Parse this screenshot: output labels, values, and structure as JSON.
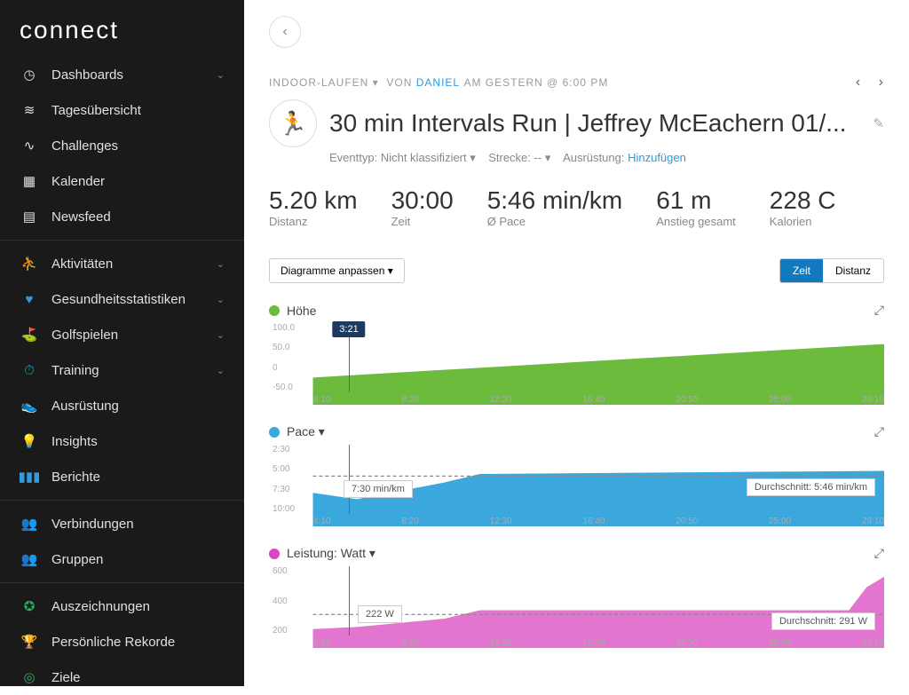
{
  "logo": "connect",
  "nav": {
    "dashboards": "Dashboards",
    "tagesuebersicht": "Tagesübersicht",
    "challenges": "Challenges",
    "kalender": "Kalender",
    "newsfeed": "Newsfeed",
    "aktivitaeten": "Aktivitäten",
    "gesundheit": "Gesundheitsstatistiken",
    "golf": "Golfspielen",
    "training": "Training",
    "ausruestung": "Ausrüstung",
    "insights": "Insights",
    "berichte": "Berichte",
    "verbindungen": "Verbindungen",
    "gruppen": "Gruppen",
    "auszeichnungen": "Auszeichnungen",
    "rekorde": "Persönliche Rekorde",
    "ziele": "Ziele"
  },
  "crumb": {
    "type": "INDOOR-LAUFEN",
    "pre": "VON",
    "user": "DANIEL",
    "time": "AM GESTERN @ 6:00 PM"
  },
  "title": "30 min Intervals Run | Jeffrey McEachern 01/...",
  "subline": {
    "eventtyp_lbl": "Eventtyp:",
    "eventtyp_val": "Nicht klassifiziert",
    "strecke_lbl": "Strecke:",
    "strecke_val": "--",
    "ausruestung_lbl": "Ausrüstung:",
    "ausruestung_link": "Hinzufügen"
  },
  "stats": {
    "distanz_val": "5.20 km",
    "distanz_lbl": "Distanz",
    "zeit_val": "30:00",
    "zeit_lbl": "Zeit",
    "pace_val": "5:46 min/km",
    "pace_lbl": "Ø Pace",
    "anstieg_val": "61 m",
    "anstieg_lbl": "Anstieg gesamt",
    "kal_val": "228 C",
    "kal_lbl": "Kalorien"
  },
  "tools": {
    "customize": "Diagramme anpassen ▾",
    "zeit": "Zeit",
    "distanz": "Distanz"
  },
  "charts": {
    "hoehe": {
      "title": "Höhe",
      "color": "#6cbb3c",
      "cursor_time": "3:21"
    },
    "pace": {
      "title": "Pace ▾",
      "color": "#3ba8dd",
      "cursor_val": "7:30 min/km",
      "avg": "Durchschnitt: 5:46 min/km"
    },
    "leistung": {
      "title": "Leistung: Watt ▾",
      "color": "#d946bf",
      "cursor_val": "222 W",
      "avg": "Durchschnitt: 291 W"
    },
    "xticks": [
      "4:10",
      "8:20",
      "12:30",
      "16:40",
      "20:50",
      "25:00",
      "29:10"
    ],
    "hoehe_yticks": [
      "100.0",
      "50.0",
      "0",
      "-50.0"
    ],
    "pace_yticks": [
      "2:30",
      "5:00",
      "7:30",
      "10:00"
    ],
    "leistung_yticks": [
      "600",
      "400",
      "200"
    ]
  },
  "chart_data": [
    {
      "type": "area",
      "title": "Höhe",
      "ylabel": "m",
      "ylim": [
        -50,
        100
      ],
      "x": [
        0,
        4.17,
        8.33,
        12.5,
        16.67,
        20.83,
        25.0,
        29.17,
        30
      ],
      "values": [
        0,
        8,
        16,
        24,
        32,
        40,
        48,
        56,
        61
      ]
    },
    {
      "type": "area",
      "title": "Pace",
      "ylabel": "min/km",
      "ylim": [
        10,
        2.5
      ],
      "x": [
        0,
        3.35,
        4.17,
        8.33,
        12.5,
        16.67,
        20.83,
        25.0,
        29.17,
        30
      ],
      "values": [
        7.0,
        7.5,
        7.3,
        6.0,
        5.3,
        5.3,
        5.3,
        5.3,
        5.0,
        4.0
      ],
      "avg_line": 5.77
    },
    {
      "type": "area",
      "title": "Leistung",
      "ylabel": "W",
      "ylim": [
        0,
        600
      ],
      "x": [
        0,
        3.35,
        4.17,
        8.33,
        12.5,
        16.67,
        20.83,
        25.0,
        29.17,
        30
      ],
      "values": [
        210,
        222,
        215,
        250,
        300,
        300,
        300,
        300,
        310,
        480
      ],
      "avg_line": 291
    }
  ]
}
